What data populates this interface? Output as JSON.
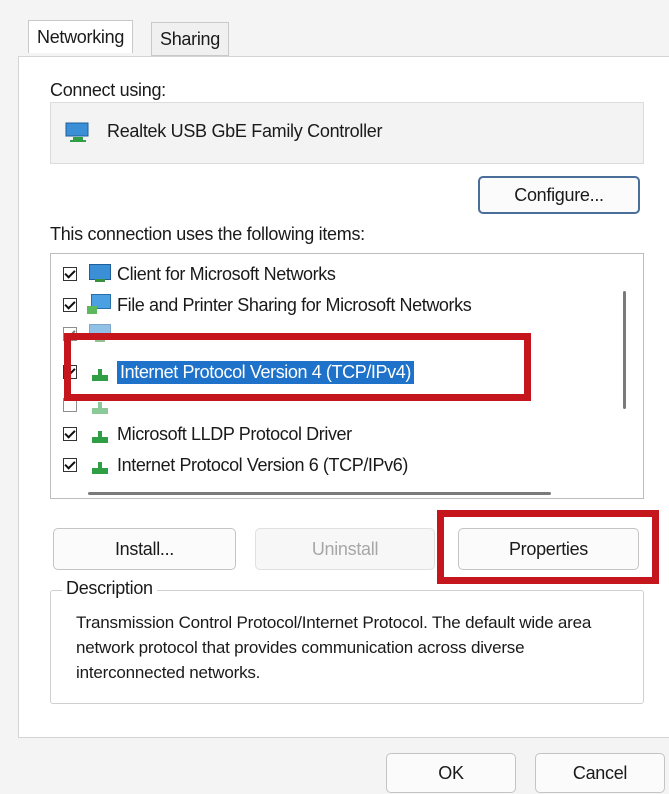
{
  "tabs": [
    {
      "label": "Networking",
      "active": true
    },
    {
      "label": "Sharing",
      "active": false
    }
  ],
  "connect_using_label": "Connect using:",
  "adapter": {
    "name": "Realtek USB GbE Family Controller",
    "icon": "network-adapter-icon"
  },
  "configure_button": "Configure...",
  "items_label": "This connection uses the following items:",
  "items": [
    {
      "label": "Client for Microsoft Networks",
      "checked": true,
      "icon": "network-client-icon"
    },
    {
      "label": "File and Printer Sharing for Microsoft Networks",
      "checked": true,
      "icon": "file-sharing-icon"
    },
    {
      "label": "Internet Protocol Version 4 (TCP/IPv4)",
      "checked": true,
      "selected": true,
      "icon": "protocol-icon"
    },
    {
      "label": "Microsoft LLDP Protocol Driver",
      "checked": true,
      "icon": "protocol-icon"
    },
    {
      "label": "Internet Protocol Version 6 (TCP/IPv6)",
      "checked": true,
      "icon": "protocol-icon"
    }
  ],
  "buttons": {
    "install": "Install...",
    "uninstall": "Uninstall",
    "properties": "Properties",
    "ok": "OK",
    "cancel": "Cancel"
  },
  "description": {
    "legend": "Description",
    "text": "Transmission Control Protocol/Internet Protocol. The default wide area network protocol that provides communication across diverse interconnected networks."
  },
  "colors": {
    "highlight_red": "#c4161c",
    "selection_blue": "#1e72c9",
    "primary_border": "#4a6e9a"
  }
}
